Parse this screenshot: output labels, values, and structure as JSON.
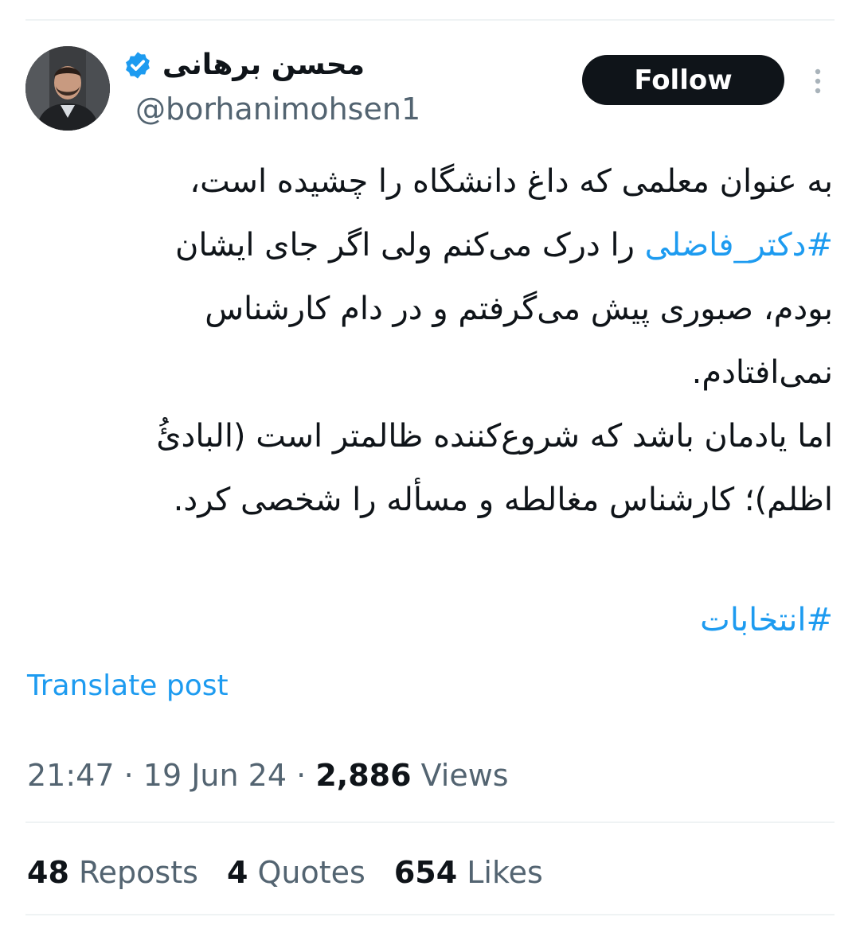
{
  "author": {
    "display_name": "محسن برهانی",
    "handle": "@borhanimohsen1",
    "avatar_icon": "profile-photo",
    "verified_icon": "verified-badge-icon"
  },
  "follow_button": {
    "label": "Follow"
  },
  "tweet": {
    "lines": [
      {
        "parts": [
          {
            "text": "به عنوان معلمی که داغ دانشگاه را چشیده است،",
            "hashtag": false
          }
        ]
      },
      {
        "parts": [
          {
            "text": "#دکتر_فاضلی",
            "hashtag": true
          },
          {
            "text": " را درک می‌کنم ولی اگر جای ایشان",
            "hashtag": false
          }
        ]
      },
      {
        "parts": [
          {
            "text": "بودم، صبوری پیش می‌گرفتم و در دام کارشناس",
            "hashtag": false
          }
        ]
      },
      {
        "parts": [
          {
            "text": "نمی‌افتادم.",
            "hashtag": false
          }
        ]
      },
      {
        "parts": [
          {
            "text": "اما یادمان باشد که شروع‌کننده ظالمتر است (البادئُ",
            "hashtag": false
          }
        ]
      },
      {
        "parts": [
          {
            "text": "اظلم)؛ کارشناس مغالطه و مسأله را شخصی کرد.",
            "hashtag": false
          }
        ]
      }
    ],
    "trailing_hashtag": "#انتخابات"
  },
  "translate_link": "Translate post",
  "meta": {
    "time": "21:47",
    "separator": "·",
    "date": "19 Jun 24",
    "views_count": "2,886",
    "views_label": "Views"
  },
  "stats": [
    {
      "count": "48",
      "label": "Reposts",
      "name": "reposts"
    },
    {
      "count": "4",
      "label": "Quotes",
      "name": "quotes"
    },
    {
      "count": "654",
      "label": "Likes",
      "name": "likes"
    }
  ],
  "colors": {
    "accent": "#1d9bf0",
    "text": "#0f1419",
    "secondary": "#536471",
    "divider": "#eff3f4",
    "button_bg": "#0f1419"
  }
}
